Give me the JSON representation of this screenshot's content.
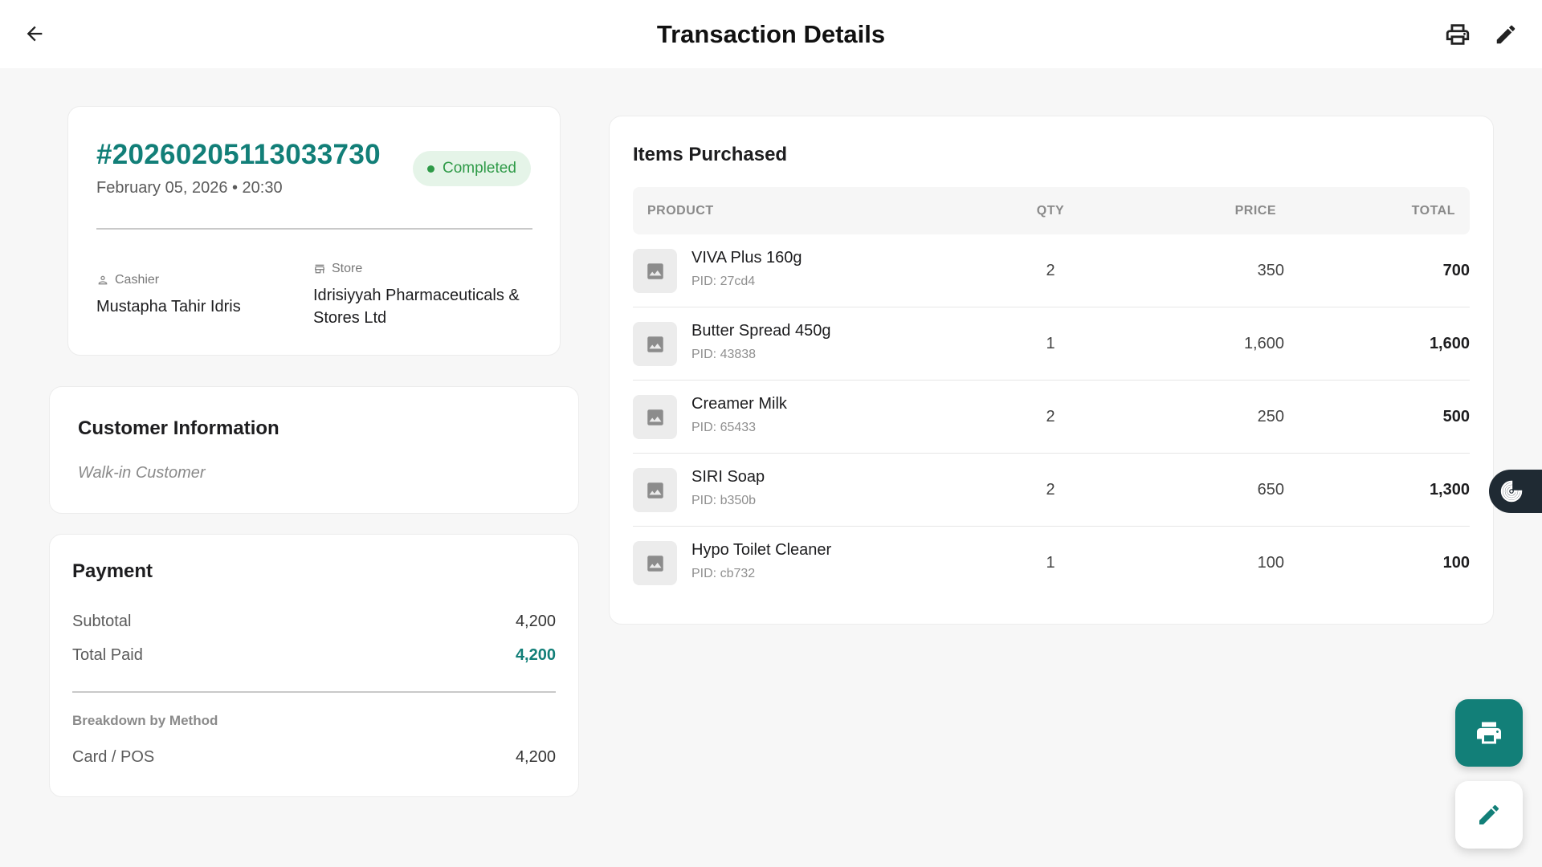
{
  "header": {
    "title": "Transaction Details",
    "back_icon": "arrow-left-icon",
    "print_icon": "printer-icon",
    "edit_icon": "pencil-icon"
  },
  "transaction": {
    "id": "#20260205113033730",
    "date": "February 05, 2026 • 20:30",
    "status": "Completed",
    "cashier_label": "Cashier",
    "cashier": "Mustapha Tahir Idris",
    "store_label": "Store",
    "store": "Idrisiyyah Pharmaceuticals & Stores Ltd"
  },
  "customer": {
    "title": "Customer Information",
    "name": "Walk-in Customer"
  },
  "payment": {
    "title": "Payment",
    "subtotal_label": "Subtotal",
    "subtotal": "4,200",
    "total_paid_label": "Total Paid",
    "total_paid": "4,200",
    "breakdown_label": "Breakdown by Method",
    "methods": [
      {
        "label": "Card / POS",
        "amount": "4,200"
      }
    ]
  },
  "items": {
    "title": "Items Purchased",
    "columns": {
      "product": "PRODUCT",
      "qty": "QTY",
      "price": "PRICE",
      "total": "TOTAL"
    },
    "rows": [
      {
        "name": "VIVA Plus 160g",
        "pid": "PID: 27cd4",
        "qty": "2",
        "price": "350",
        "total": "700"
      },
      {
        "name": "Butter Spread 450g",
        "pid": "PID: 43838",
        "qty": "1",
        "price": "1,600",
        "total": "1,600"
      },
      {
        "name": "Creamer Milk",
        "pid": "PID: 65433",
        "qty": "2",
        "price": "250",
        "total": "500"
      },
      {
        "name": "SIRI Soap",
        "pid": "PID: b350b",
        "qty": "2",
        "price": "650",
        "total": "1,300"
      },
      {
        "name": "Hypo Toilet Cleaner",
        "pid": "PID: cb732",
        "qty": "1",
        "price": "100",
        "total": "100"
      }
    ]
  },
  "colors": {
    "accent": "#127f78",
    "status_green": "#2e9a47",
    "status_bg": "#e5f4e8",
    "page_bg": "#f7f7f7",
    "side_tab": "#1f2a33"
  }
}
